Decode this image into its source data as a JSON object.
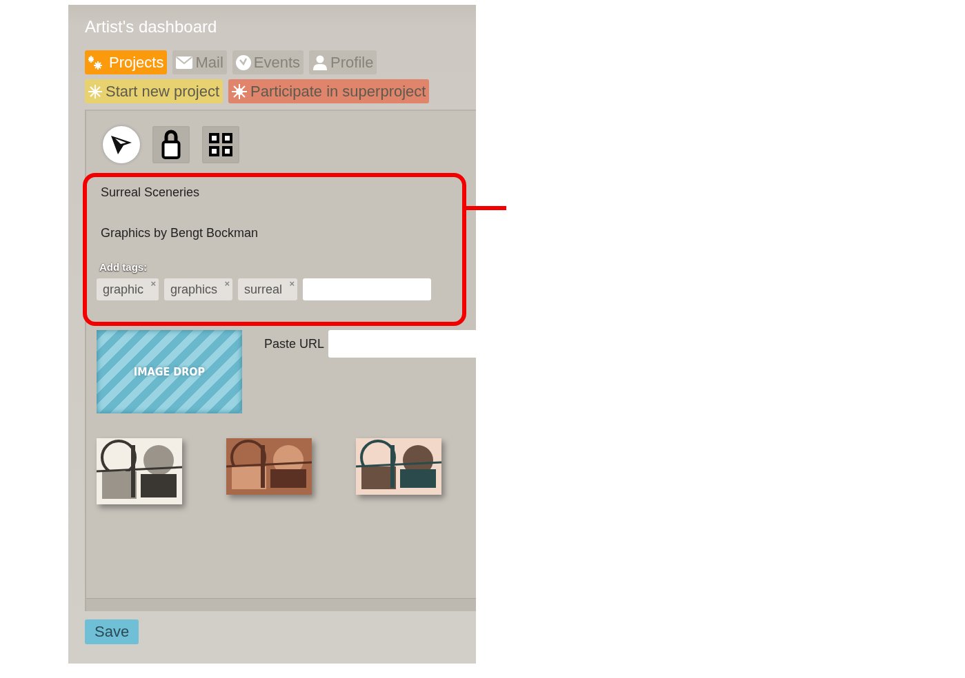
{
  "title": "Artist's dashboard",
  "tabs": [
    {
      "kind": "projects",
      "label": "Projects",
      "selected": true
    },
    {
      "kind": "mail",
      "label": "Mail",
      "selected": false
    },
    {
      "kind": "events",
      "label": "Events",
      "selected": false
    },
    {
      "kind": "profile",
      "label": "Profile",
      "selected": false
    }
  ],
  "actions": [
    {
      "kind": "start",
      "label": "Start new project",
      "color": "#e8d270"
    },
    {
      "kind": "participate",
      "label": "Participate in superproject",
      "color": "#e0846c"
    }
  ],
  "tools": [
    {
      "kind": "pointer"
    },
    {
      "kind": "lock"
    },
    {
      "kind": "grid"
    }
  ],
  "info": {
    "title": "Surreal Sceneries",
    "credit": "Graphics by Bengt Bockman",
    "tags_label": "Add tags:",
    "tags": [
      {
        "label": "graphic",
        "remove": "×"
      },
      {
        "label": "graphics",
        "remove": "×"
      },
      {
        "label": "surreal",
        "remove": "×"
      }
    ]
  },
  "image_drop": {
    "label": "IMAGE DROP"
  },
  "paste_url": {
    "label": "Paste URL"
  },
  "save": {
    "label": "Save"
  }
}
